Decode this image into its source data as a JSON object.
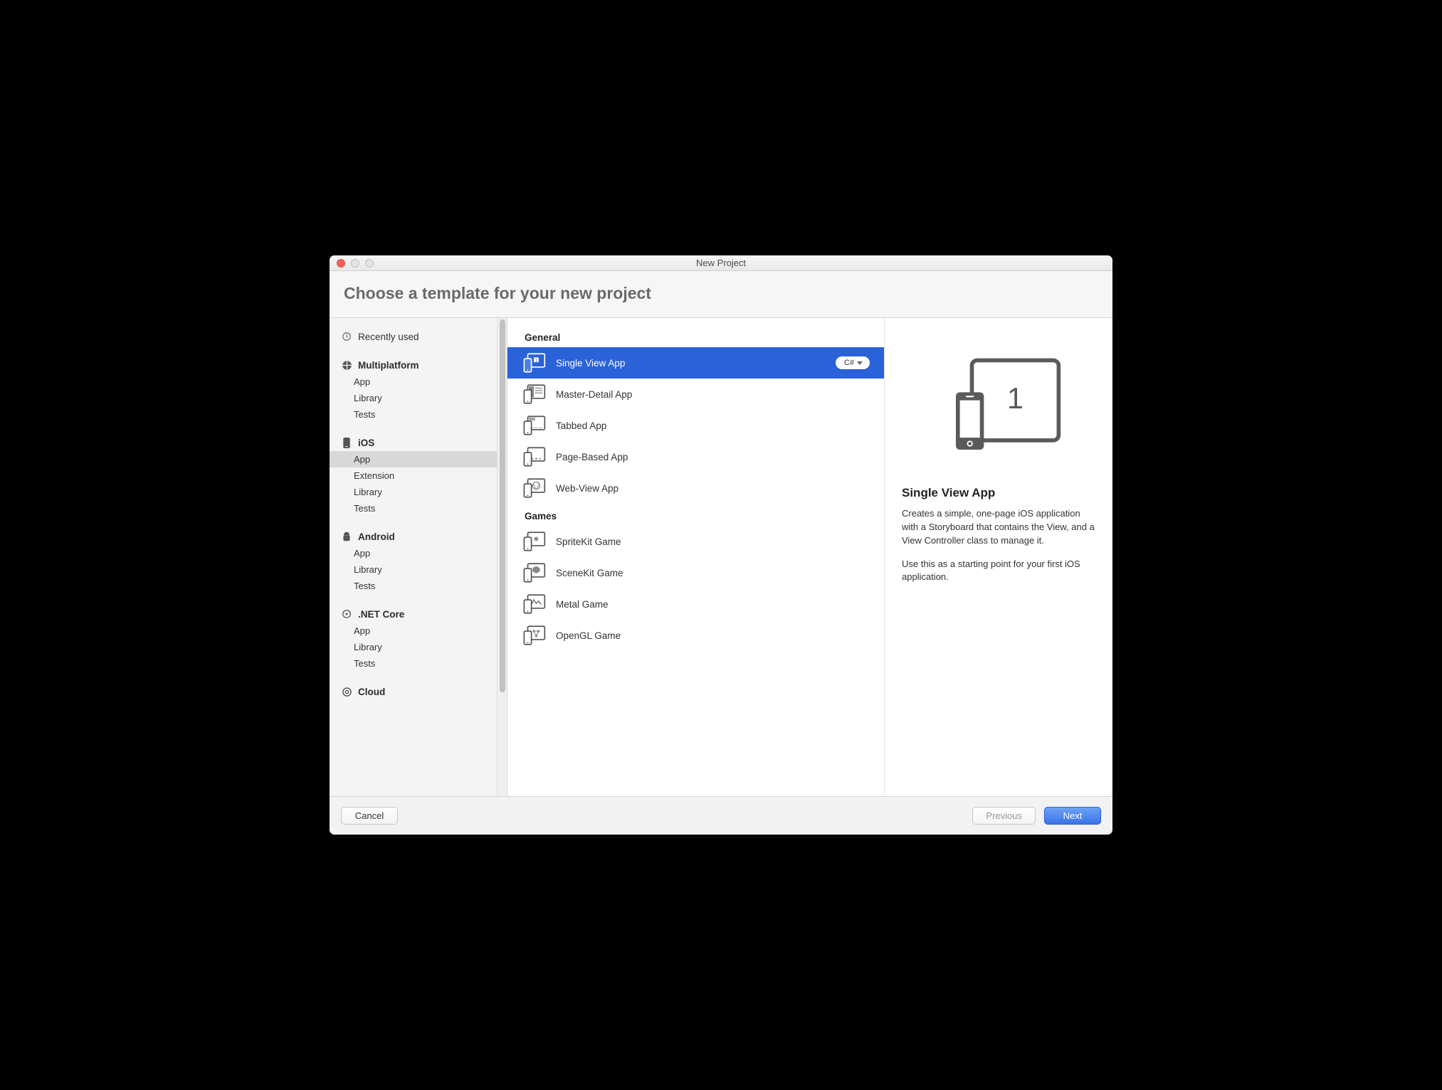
{
  "window": {
    "title": "New Project"
  },
  "header": {
    "heading": "Choose a template for your new project"
  },
  "sidebar": {
    "recent_label": "Recently used",
    "sections": [
      {
        "title": "Multiplatform",
        "items": [
          "App",
          "Library",
          "Tests"
        ]
      },
      {
        "title": "iOS",
        "items": [
          "App",
          "Extension",
          "Library",
          "Tests"
        ],
        "selected_index": 0
      },
      {
        "title": "Android",
        "items": [
          "App",
          "Library",
          "Tests"
        ]
      },
      {
        "title": ".NET Core",
        "items": [
          "App",
          "Library",
          "Tests"
        ]
      },
      {
        "title": "Cloud",
        "items": []
      }
    ]
  },
  "templates": {
    "language_badge": "C#",
    "groups": [
      {
        "title": "General",
        "items": [
          {
            "label": "Single View App",
            "selected": true
          },
          {
            "label": "Master-Detail App"
          },
          {
            "label": "Tabbed App"
          },
          {
            "label": "Page-Based App"
          },
          {
            "label": "Web-View App"
          }
        ]
      },
      {
        "title": "Games",
        "items": [
          {
            "label": "SpriteKit Game"
          },
          {
            "label": "SceneKit Game"
          },
          {
            "label": "Metal Game"
          },
          {
            "label": "OpenGL Game"
          }
        ]
      }
    ]
  },
  "detail": {
    "illustration_number": "1",
    "title": "Single View App",
    "p1": "Creates a simple, one-page iOS application with a Storyboard that contains the View, and a View Controller class to manage it.",
    "p2": "Use this as a starting point for your first iOS application."
  },
  "footer": {
    "cancel": "Cancel",
    "previous": "Previous",
    "next": "Next"
  }
}
